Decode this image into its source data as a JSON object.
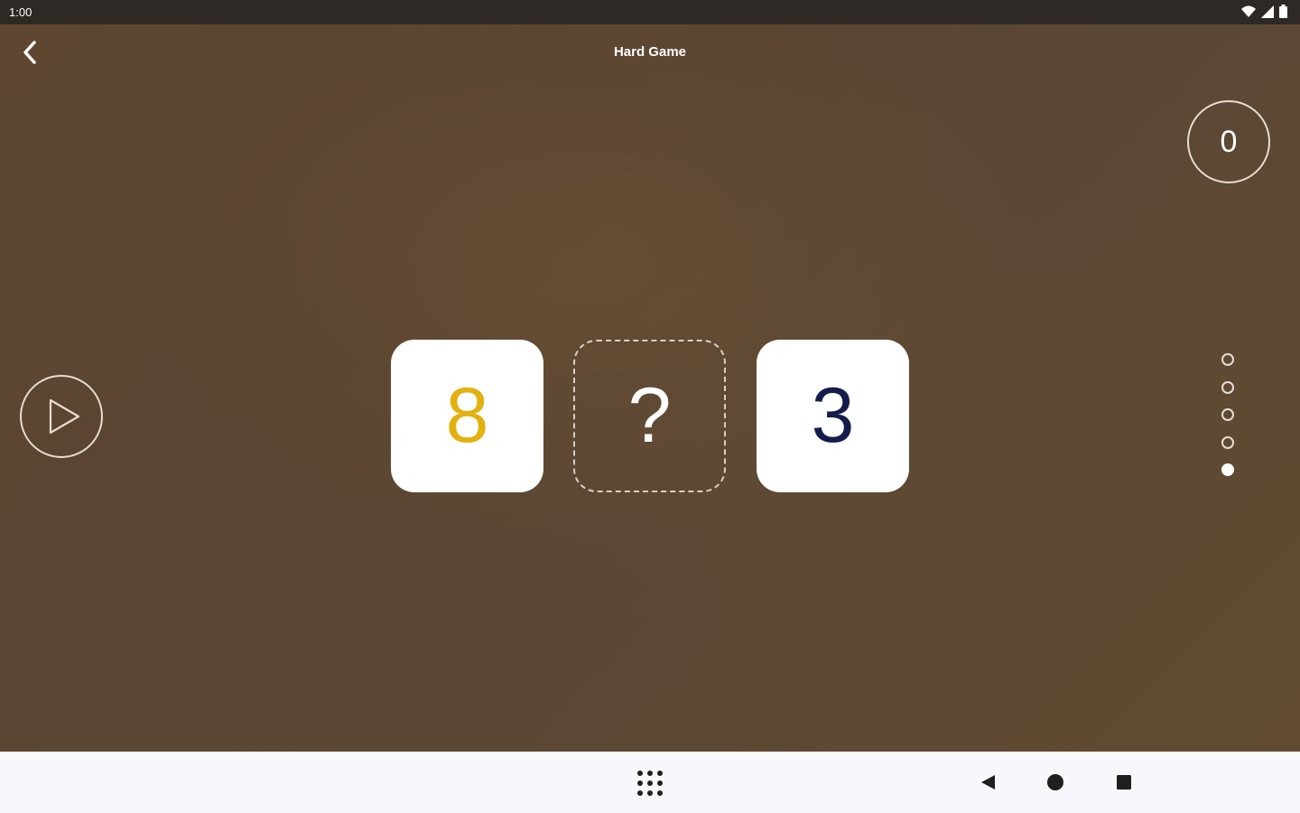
{
  "status_bar": {
    "time": "1:00",
    "icons": [
      "wifi-icon",
      "signal-icon",
      "battery-icon"
    ]
  },
  "header": {
    "title": "Hard Game",
    "back_icon": "chevron-left-icon"
  },
  "score": {
    "value": "0"
  },
  "play_button": {
    "icon": "play-icon"
  },
  "cards": [
    {
      "text": "8",
      "kind": "number",
      "color": "#e2b10f"
    },
    {
      "text": "?",
      "kind": "slot",
      "color": "#ffffff"
    },
    {
      "text": "3",
      "kind": "number",
      "color": "#141c4c"
    }
  ],
  "progress": {
    "total": 5,
    "current": 5
  },
  "nav_bar": {
    "icons": [
      "app-grid-icon",
      "nav-back-icon",
      "nav-home-icon",
      "nav-recents-icon"
    ]
  }
}
